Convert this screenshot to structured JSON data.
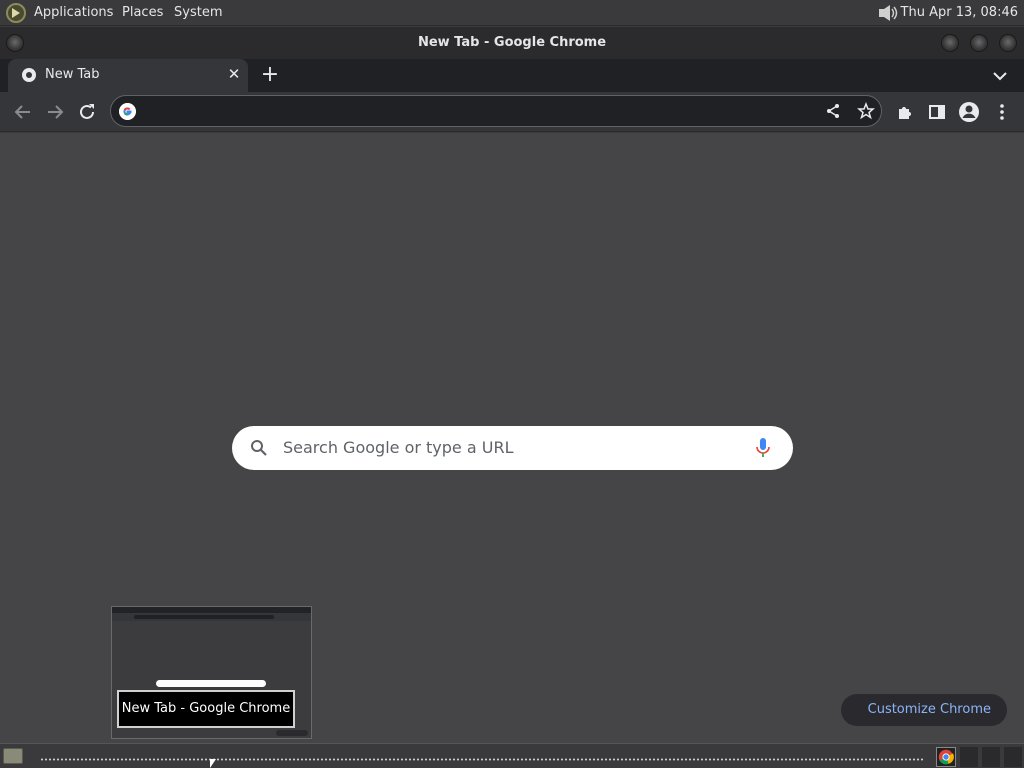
{
  "top_panel": {
    "menus": [
      "Applications",
      "Places",
      "System"
    ],
    "clock": "Thu Apr 13, 08:46"
  },
  "window": {
    "title": "New Tab - Google Chrome"
  },
  "tabs": [
    {
      "title": "New Tab",
      "active": true
    }
  ],
  "toolbar": {
    "omnibox_value": ""
  },
  "ntp": {
    "search_placeholder": "Search Google or type a URL",
    "customize_label": "Customize Chrome"
  },
  "taskbar": {
    "preview_label": "New Tab - Google Chrome"
  },
  "colors": {
    "content_bg": "#454548",
    "toolbar_bg": "#35363a",
    "tabstrip_bg": "#202124",
    "accent_link": "#8ab4f8"
  }
}
